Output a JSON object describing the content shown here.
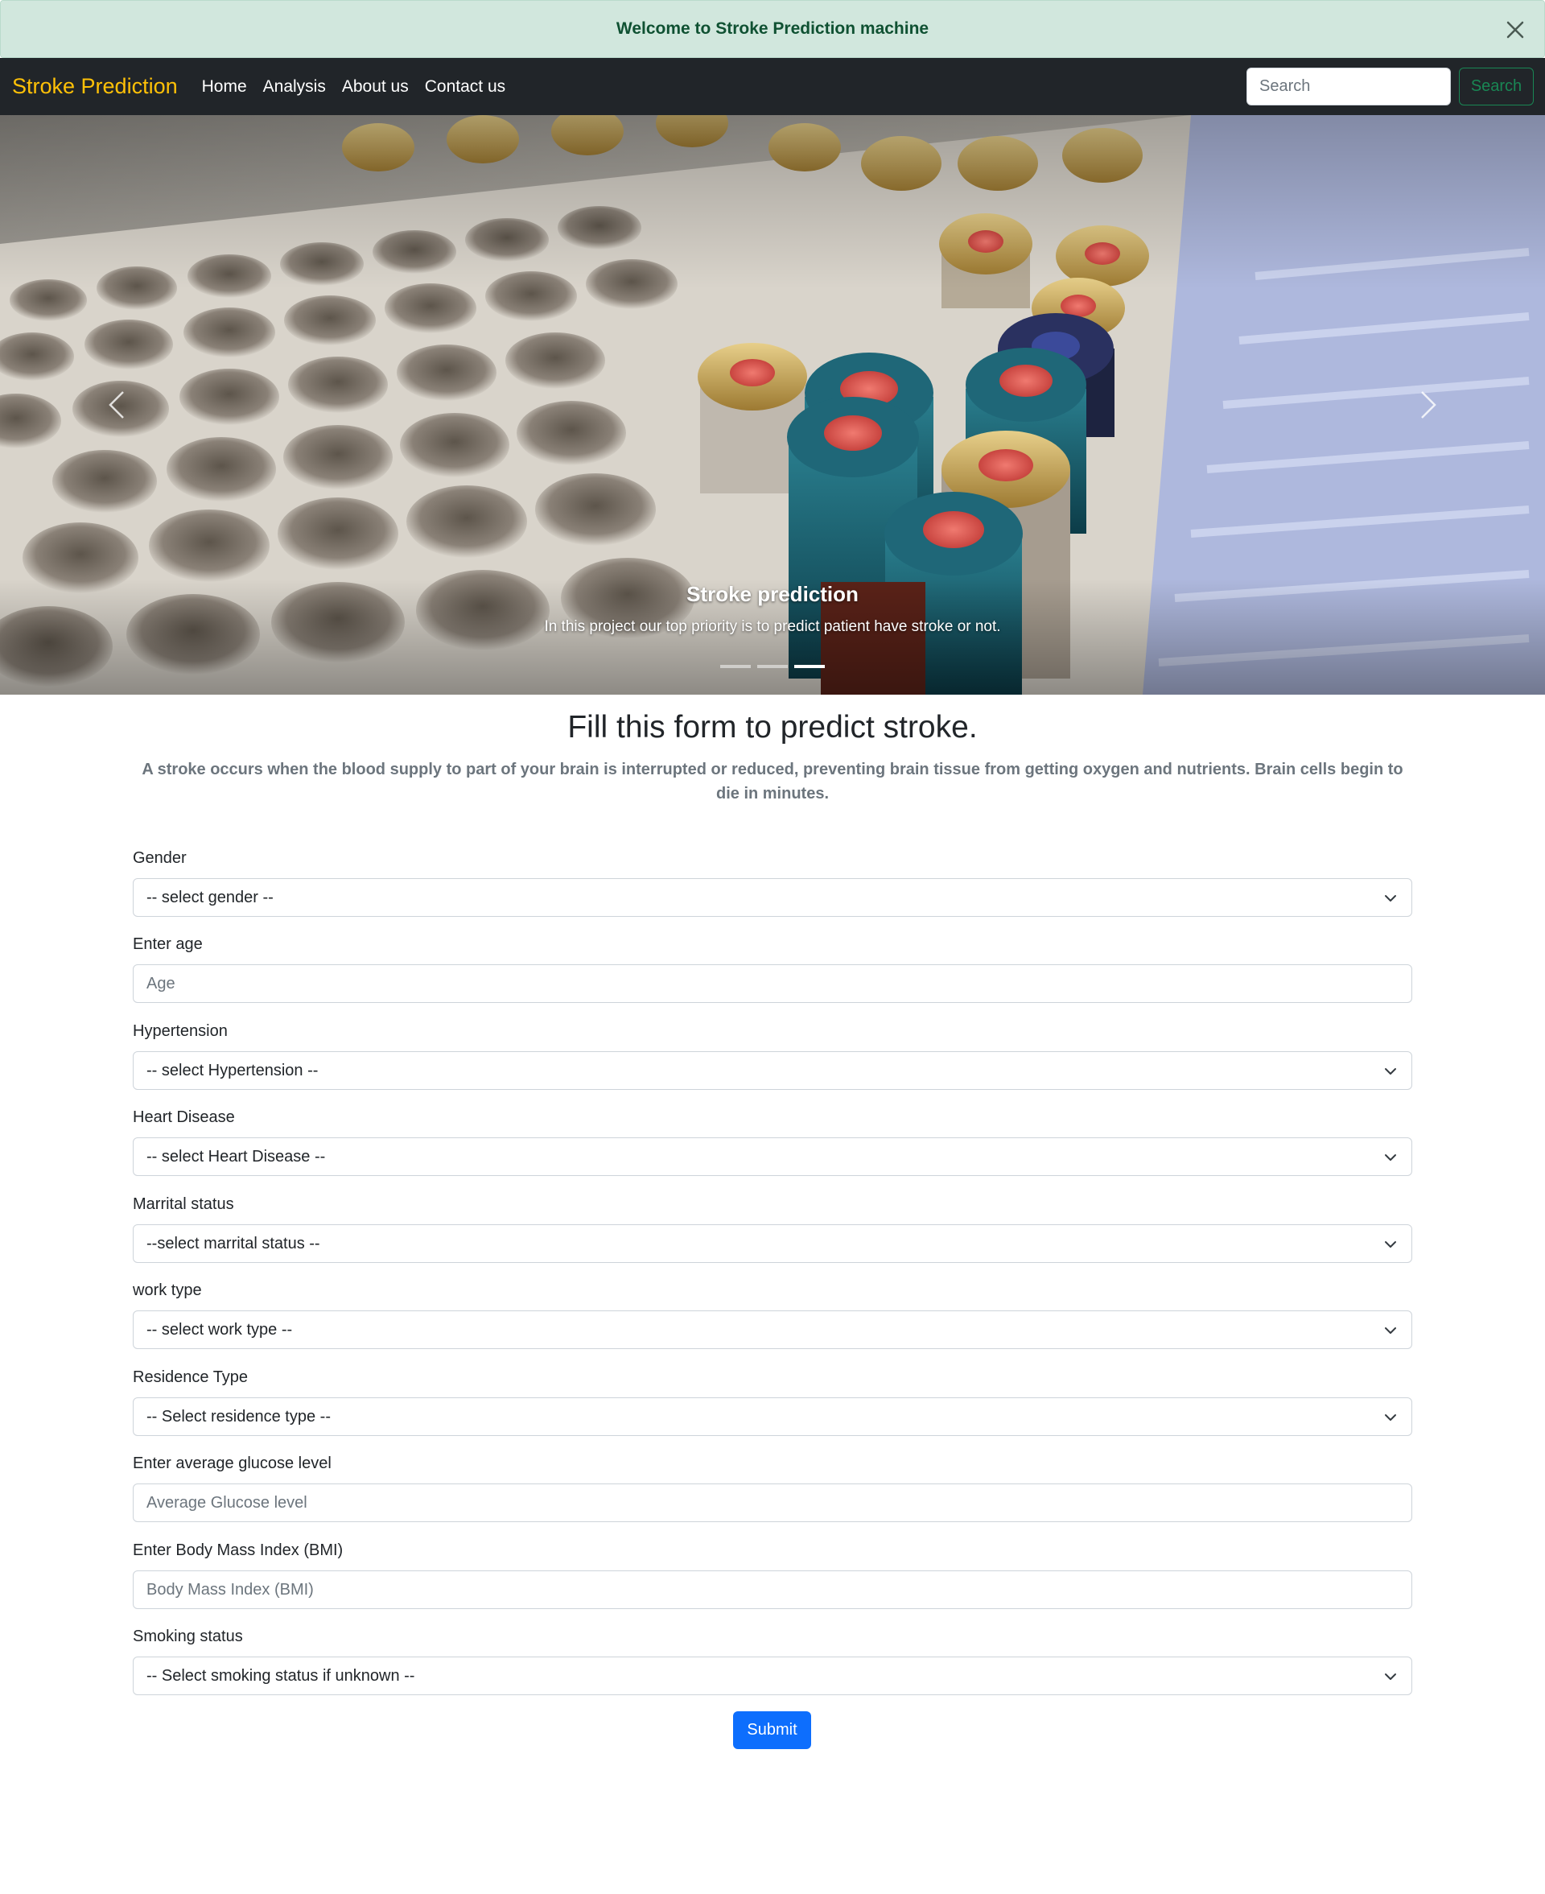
{
  "alert": {
    "message": "Welcome to Stroke Prediction machine"
  },
  "navbar": {
    "brand": "Stroke Prediction",
    "links": [
      "Home",
      "Analysis",
      "About us",
      "Contact us"
    ],
    "search_placeholder": "Search",
    "search_button": "Search"
  },
  "carousel": {
    "caption_title": "Stroke prediction",
    "caption_text": "In this project our top priority is to predict patient have stroke or not.",
    "active_slide": 3,
    "slide_count": 3
  },
  "form": {
    "title": "Fill this form to predict stroke.",
    "description": "A stroke occurs when the blood supply to part of your brain is interrupted or reduced, preventing brain tissue from getting oxygen and nutrients. Brain cells begin to die in minutes.",
    "fields": [
      {
        "label": "Gender",
        "type": "select",
        "value": "-- select gender --"
      },
      {
        "label": "Enter age",
        "type": "input",
        "placeholder": "Age"
      },
      {
        "label": "Hypertension",
        "type": "select",
        "value": "-- select Hypertension --"
      },
      {
        "label": "Heart Disease",
        "type": "select",
        "value": "-- select Heart Disease --"
      },
      {
        "label": "Marrital status",
        "type": "select",
        "value": "--select marrital status --"
      },
      {
        "label": "work type",
        "type": "select",
        "value": "-- select work type --"
      },
      {
        "label": "Residence Type",
        "type": "select",
        "value": "-- Select residence type --"
      },
      {
        "label": "Enter average glucose level",
        "type": "input",
        "placeholder": "Average Glucose level"
      },
      {
        "label": "Enter Body Mass Index (BMI)",
        "type": "input",
        "placeholder": "Body Mass Index (BMI)"
      },
      {
        "label": "Smoking status",
        "type": "select",
        "value": "-- Select smoking status if unknown --"
      }
    ],
    "submit": "Submit"
  },
  "colors": {
    "brand": "#ffc107",
    "navbar_bg": "#212529",
    "alert_bg": "#d1e7dd",
    "alert_text": "#0f5132",
    "primary": "#0d6efd",
    "success": "#198754"
  }
}
